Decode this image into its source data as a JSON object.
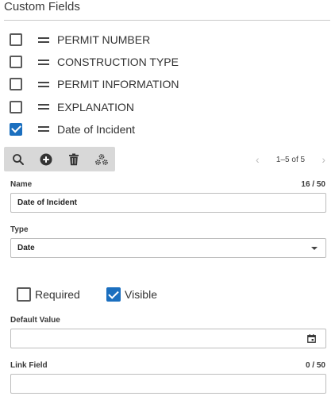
{
  "header": {
    "title": "Custom Fields"
  },
  "fields": [
    {
      "label": "PERMIT NUMBER",
      "checked": false
    },
    {
      "label": "CONSTRUCTION TYPE",
      "checked": false
    },
    {
      "label": "PERMIT INFORMATION",
      "checked": false
    },
    {
      "label": "EXPLANATION",
      "checked": false
    },
    {
      "label": "Date of Incident",
      "checked": true
    }
  ],
  "toolbar": {
    "icons": [
      "search-icon",
      "add-circle-icon",
      "trash-icon",
      "gears-icon"
    ]
  },
  "pager": {
    "text": "1–5 of 5",
    "prev": "‹",
    "next": "›"
  },
  "form": {
    "name": {
      "label": "Name",
      "counter": "16 / 50",
      "value": "Date of Incident"
    },
    "type": {
      "label": "Type",
      "value": "Date"
    },
    "required": {
      "label": "Required",
      "checked": false
    },
    "visible": {
      "label": "Visible",
      "checked": true
    },
    "default_value": {
      "label": "Default Value",
      "value": ""
    },
    "link_field": {
      "label": "Link Field",
      "counter": "0 / 50",
      "value": ""
    }
  },
  "colors": {
    "accent": "#1b6fbf",
    "toolbar_bg": "#d8d8d8",
    "border": "#bdbdbd"
  }
}
